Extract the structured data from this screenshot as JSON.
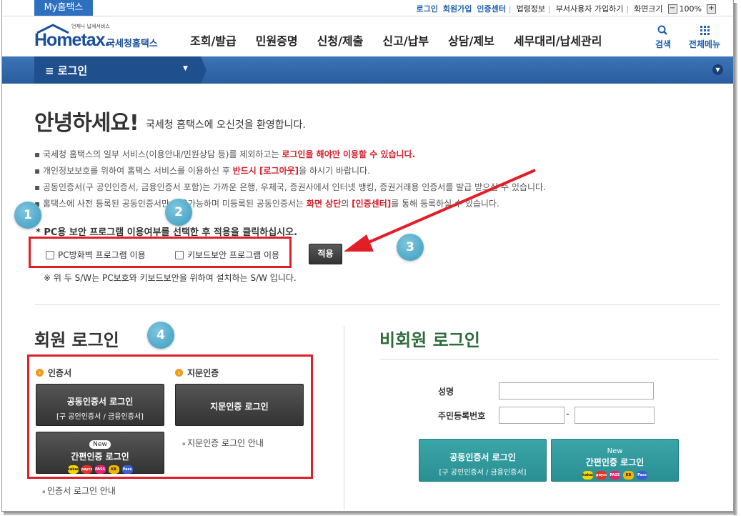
{
  "util": {
    "my_hometax": "My홈택스",
    "links": [
      "로그인",
      "회원가입",
      "인증센터"
    ],
    "links_gray": [
      "법령정보",
      "부서사용자 가입하기",
      "화면크기"
    ],
    "zoom_minus": "−",
    "zoom_value": "100%",
    "zoom_plus": "+"
  },
  "header": {
    "logo_small": "언제나 납세서비스",
    "logo_main": "Hometax.",
    "logo_kor": "국세청홈택스",
    "menu": [
      "조회/발급",
      "민원증명",
      "신청/제출",
      "신고/납부",
      "상담/제보",
      "세무대리/납세관리"
    ],
    "search_label": "검색",
    "all_menu_label": "전체메뉴"
  },
  "bluebar": {
    "title": "≡  로그인"
  },
  "greeting": {
    "title": "안녕하세요!",
    "subtitle": "국세청 홈택스에 오신것을 환영합니다."
  },
  "notices": {
    "n1_a": "▪ 국세청 홈택스의 일부 서비스(이용안내/민원상담 등)를 제외하고는 ",
    "n1_red": "로그인을 해야만 이용할 수 있습니다.",
    "n2_a": "▪ 개인정보보호를 위하여 홈택스 서비스를 이용하신 후 ",
    "n2_red": "반드시 [로그아웃]",
    "n2_b": "을 하시기 바랍니다.",
    "n3": "▪ 공동인증서(구 공인인증서, 금융인증서 포함)는 가까운 은행, 우체국, 증권사에서 인터넷 뱅킹, 증권거래용 인증서를 발급 받으실 수 있습니다.",
    "n4_a": "▪ 홈택스에 사전 등록된 공동인증서만 사용가능하며 미등록된 공동인증서는 ",
    "n4_red1": "화면 상단",
    "n4_b": "의 ",
    "n4_red2": "[인증센터]",
    "n4_c": "를 통해 등록하실 수 있습니다."
  },
  "security": {
    "label": "* PC용 보안 프로그램 이용여부를 선택한 후 적용을 클릭하십시오.",
    "firewall": "PC방화벽 프로그램 이용",
    "keyboard": "키보드보안 프로그램 이용",
    "apply": "적용",
    "note": "※ 위 두 S/W는 PC보호와 키보드보안을 위하여 설치하는 S/W 입니다."
  },
  "badges": [
    "1",
    "2",
    "3",
    "4"
  ],
  "member": {
    "title": "회원 로그인",
    "cert_head": "인증서",
    "finger_head": "지문인증",
    "cert_btn_l1": "공동인증서 로그인",
    "cert_btn_l2": "[구 공인인증서 / 금융인증서]",
    "finger_btn": "지문인증 로그인",
    "simple_new": "New",
    "simple_btn": "간편인증 로그인",
    "finger_guide": "지문인증 로그인 안내",
    "cert_guide": "인증서 로그인 안내"
  },
  "guest": {
    "title": "비회원 로그인",
    "name_label": "성명",
    "rrn_label": "주민등록번호",
    "dash": "-",
    "cert_btn_l1": "공동인증서 로그인",
    "cert_btn_l2": "[구 공인인증서 / 금융인증서]",
    "simple_new": "New",
    "simple_btn": "간편인증 로그인"
  },
  "chips": [
    {
      "label": "kakao",
      "color": "#f5d400"
    },
    {
      "label": "payco",
      "color": "#e2322c"
    },
    {
      "label": "PASS",
      "color": "#e6236e"
    },
    {
      "label": "KB",
      "color": "#f2b705"
    },
    {
      "label": "Pass",
      "color": "#3a5fcf"
    }
  ],
  "colors": {
    "brand_blue": "#1b4e9b",
    "alert_red": "#d3202c",
    "highlight_box": "#e21e28",
    "badge_teal": "#3a9bbf",
    "guest_green": "#2d6b3a",
    "teal_button": "#2a8f93"
  }
}
